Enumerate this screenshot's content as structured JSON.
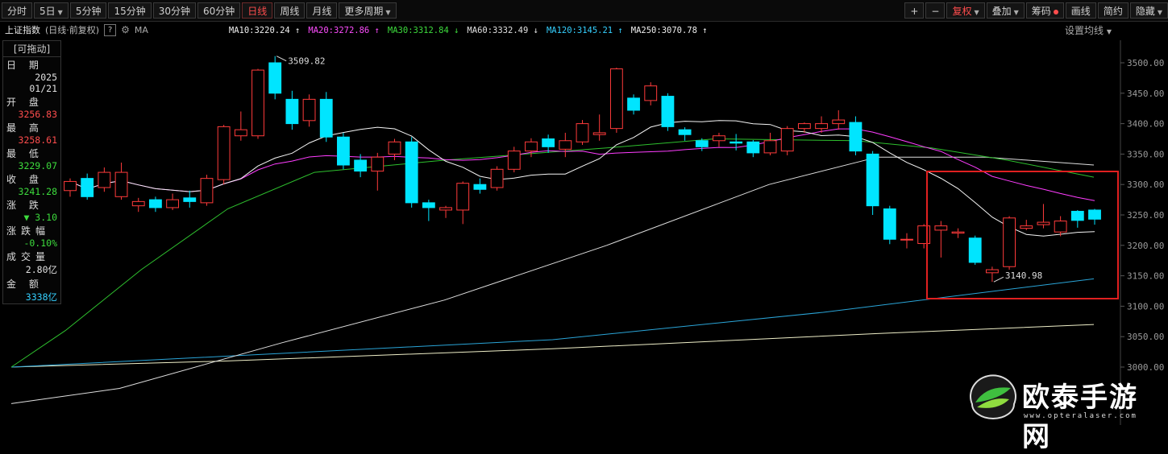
{
  "toolbar": {
    "periods": [
      {
        "label": "分时",
        "active": false,
        "caret": false
      },
      {
        "label": "5日",
        "active": false,
        "caret": true
      },
      {
        "label": "5分钟",
        "active": false,
        "caret": false
      },
      {
        "label": "15分钟",
        "active": false,
        "caret": false
      },
      {
        "label": "30分钟",
        "active": false,
        "caret": false
      },
      {
        "label": "60分钟",
        "active": false,
        "caret": false
      },
      {
        "label": "日线",
        "active": true,
        "caret": false
      },
      {
        "label": "周线",
        "active": false,
        "caret": false
      },
      {
        "label": "月线",
        "active": false,
        "caret": false
      },
      {
        "label": "更多周期",
        "active": false,
        "caret": true
      }
    ],
    "zoom_in": "+",
    "zoom_out": "−",
    "fuquan": "复权",
    "overlay": "叠加",
    "chips": "筹码",
    "draw": "画线",
    "simple": "简约",
    "hide": "隐藏"
  },
  "header": {
    "index_name": "上证指数",
    "sub": "(日线·前复权)",
    "help": "?",
    "ma_label": "MA",
    "ma_setting": "设置均线",
    "ma": [
      {
        "label": "MA10:3220.24",
        "arrow": "↑",
        "color": "#f0f0f0"
      },
      {
        "label": "MA20:3272.86",
        "arrow": "↑",
        "color": "#ff4dff"
      },
      {
        "label": "MA30:3312.84",
        "arrow": "↓",
        "color": "#3ddc3d"
      },
      {
        "label": "MA60:3332.49",
        "arrow": "↓",
        "color": "#e0e0e0"
      },
      {
        "label": "MA120:3145.21",
        "arrow": "↑",
        "color": "#35d0ff"
      },
      {
        "label": "MA250:3070.78",
        "arrow": "↑",
        "color": "#f0f0f0"
      }
    ]
  },
  "info": {
    "drag": "[可拖动]",
    "rows": [
      {
        "label": "日 期",
        "value": "2025",
        "color": "white"
      },
      {
        "label": "",
        "value": "01/21",
        "color": "white"
      },
      {
        "label": "开 盘",
        "value": "3256.83",
        "color": "red"
      },
      {
        "label": "最 高",
        "value": "3258.61",
        "color": "red"
      },
      {
        "label": "最 低",
        "value": "3229.07",
        "color": "green"
      },
      {
        "label": "收 盘",
        "value": "3241.28",
        "color": "green"
      },
      {
        "label": "涨 跌",
        "value": "▼ 3.10",
        "color": "green"
      },
      {
        "label": "涨跌幅",
        "value": "-0.10%",
        "color": "green"
      },
      {
        "label": "成交量",
        "value": "2.80亿",
        "color": "white"
      },
      {
        "label": "金 额",
        "value": "3338亿",
        "color": "cyan"
      }
    ]
  },
  "colors": {
    "up": "#ff3b3b",
    "down": "#00e5ff",
    "ma10": "#f5f5f5",
    "ma20": "#ff3dff",
    "ma30": "#2ec02e",
    "ma60": "#dedede",
    "ma120": "#2aa5d8",
    "ma250": "#efefc8",
    "highlight": "#e02020"
  },
  "chart_data": {
    "type": "candlestick",
    "ylim": [
      3000,
      3520
    ],
    "y_ticks": [
      "3500.00",
      "3450.00",
      "3400.00",
      "3350.00",
      "3300.00",
      "3250.00",
      "3200.00",
      "3150.00",
      "3100.00",
      "3050.00",
      "3000.00"
    ],
    "annotations": [
      {
        "text": "3509.82"
      },
      {
        "text": "3140.98"
      }
    ],
    "candles": [
      [
        3290,
        3305,
        3280,
        3310
      ],
      [
        3310,
        3280,
        3275,
        3318
      ],
      [
        3295,
        3320,
        3288,
        3328
      ],
      [
        3280,
        3320,
        3275,
        3336
      ],
      [
        3265,
        3272,
        3255,
        3278
      ],
      [
        3275,
        3262,
        3255,
        3280
      ],
      [
        3262,
        3275,
        3258,
        3285
      ],
      [
        3278,
        3272,
        3262,
        3290
      ],
      [
        3270,
        3310,
        3265,
        3316
      ],
      [
        3308,
        3395,
        3300,
        3398
      ],
      [
        3380,
        3390,
        3372,
        3420
      ],
      [
        3380,
        3488,
        3375,
        3490
      ],
      [
        3500,
        3450,
        3440,
        3511
      ],
      [
        3440,
        3400,
        3390,
        3454
      ],
      [
        3405,
        3440,
        3395,
        3448
      ],
      [
        3440,
        3378,
        3370,
        3452
      ],
      [
        3378,
        3332,
        3325,
        3385
      ],
      [
        3340,
        3322,
        3312,
        3350
      ],
      [
        3322,
        3345,
        3290,
        3352
      ],
      [
        3350,
        3370,
        3340,
        3375
      ],
      [
        3370,
        3270,
        3262,
        3378
      ],
      [
        3270,
        3262,
        3240,
        3275
      ],
      [
        3258,
        3262,
        3245,
        3265
      ],
      [
        3258,
        3302,
        3235,
        3305
      ],
      [
        3300,
        3292,
        3285,
        3310
      ],
      [
        3295,
        3325,
        3290,
        3330
      ],
      [
        3325,
        3355,
        3320,
        3362
      ],
      [
        3355,
        3370,
        3345,
        3376
      ],
      [
        3375,
        3362,
        3352,
        3382
      ],
      [
        3358,
        3372,
        3345,
        3385
      ],
      [
        3370,
        3400,
        3365,
        3406
      ],
      [
        3382,
        3385,
        3372,
        3415
      ],
      [
        3392,
        3490,
        3385,
        3492
      ],
      [
        3442,
        3422,
        3415,
        3448
      ],
      [
        3438,
        3462,
        3430,
        3468
      ],
      [
        3445,
        3395,
        3388,
        3450
      ],
      [
        3390,
        3382,
        3372,
        3394
      ],
      [
        3372,
        3362,
        3355,
        3376
      ],
      [
        3372,
        3380,
        3362,
        3385
      ],
      [
        3370,
        3368,
        3356,
        3383
      ],
      [
        3370,
        3352,
        3345,
        3373
      ],
      [
        3352,
        3372,
        3348,
        3385
      ],
      [
        3355,
        3392,
        3348,
        3396
      ],
      [
        3392,
        3400,
        3385,
        3402
      ],
      [
        3392,
        3400,
        3385,
        3412
      ],
      [
        3400,
        3406,
        3390,
        3422
      ],
      [
        3402,
        3355,
        3348,
        3412
      ],
      [
        3350,
        3265,
        3250,
        3355
      ],
      [
        3260,
        3210,
        3202,
        3265
      ],
      [
        3210,
        3210,
        3195,
        3220
      ],
      [
        3203,
        3232,
        3195,
        3235
      ],
      [
        3225,
        3232,
        3180,
        3240
      ],
      [
        3220,
        3222,
        3212,
        3228
      ],
      [
        3212,
        3172,
        3168,
        3216
      ],
      [
        3155,
        3160,
        3140,
        3165
      ],
      [
        3165,
        3245,
        3160,
        3248
      ],
      [
        3228,
        3232,
        3225,
        3242
      ],
      [
        3234,
        3238,
        3228,
        3268
      ],
      [
        3222,
        3240,
        3215,
        3248
      ],
      [
        3256,
        3241,
        3229,
        3258
      ],
      [
        3258,
        3243,
        3234,
        3260
      ]
    ]
  }
}
